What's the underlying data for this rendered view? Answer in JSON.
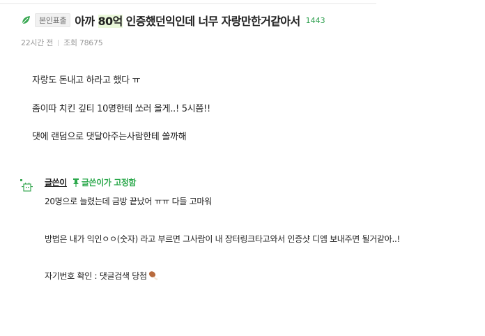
{
  "post": {
    "category": "본인표출",
    "title_parts": [
      "아까 ",
      "80억",
      " 인증했던익인데 너무 자랑만한거같아서"
    ],
    "comment_count": "1443",
    "time": "22시간 전",
    "views": "조회 78675",
    "body": [
      "자랑도 돈내고 하라고 했다 ㅠ",
      "좀이따 치킨 깊티 10명한테 쏘러 올게..! 5시쯤!!",
      "댓에 랜덤으로 댓달아주는사람한테 쏠까해"
    ]
  },
  "comment": {
    "author": "글쓴이",
    "pinned_label": "글쓴이가 고정함",
    "lines": [
      "20명으로 늘렸는데 금방 끝났어 ㅠㅠ 다들 고마워",
      "방법은 내가 익인ㅇㅇ(숫자) 라고 부르면 그사람이 내 장터링크타고와서 인증샷 디엠 보내주면 될거같아..!",
      "자기번호 확인 : 댓글검색 당첨"
    ]
  },
  "colors": {
    "accent_green": "#2da94d",
    "highlight": "#eaf8da"
  },
  "icons": [
    "leaf-icon",
    "avatar-icon",
    "pin-icon",
    "drumstick-icon"
  ]
}
